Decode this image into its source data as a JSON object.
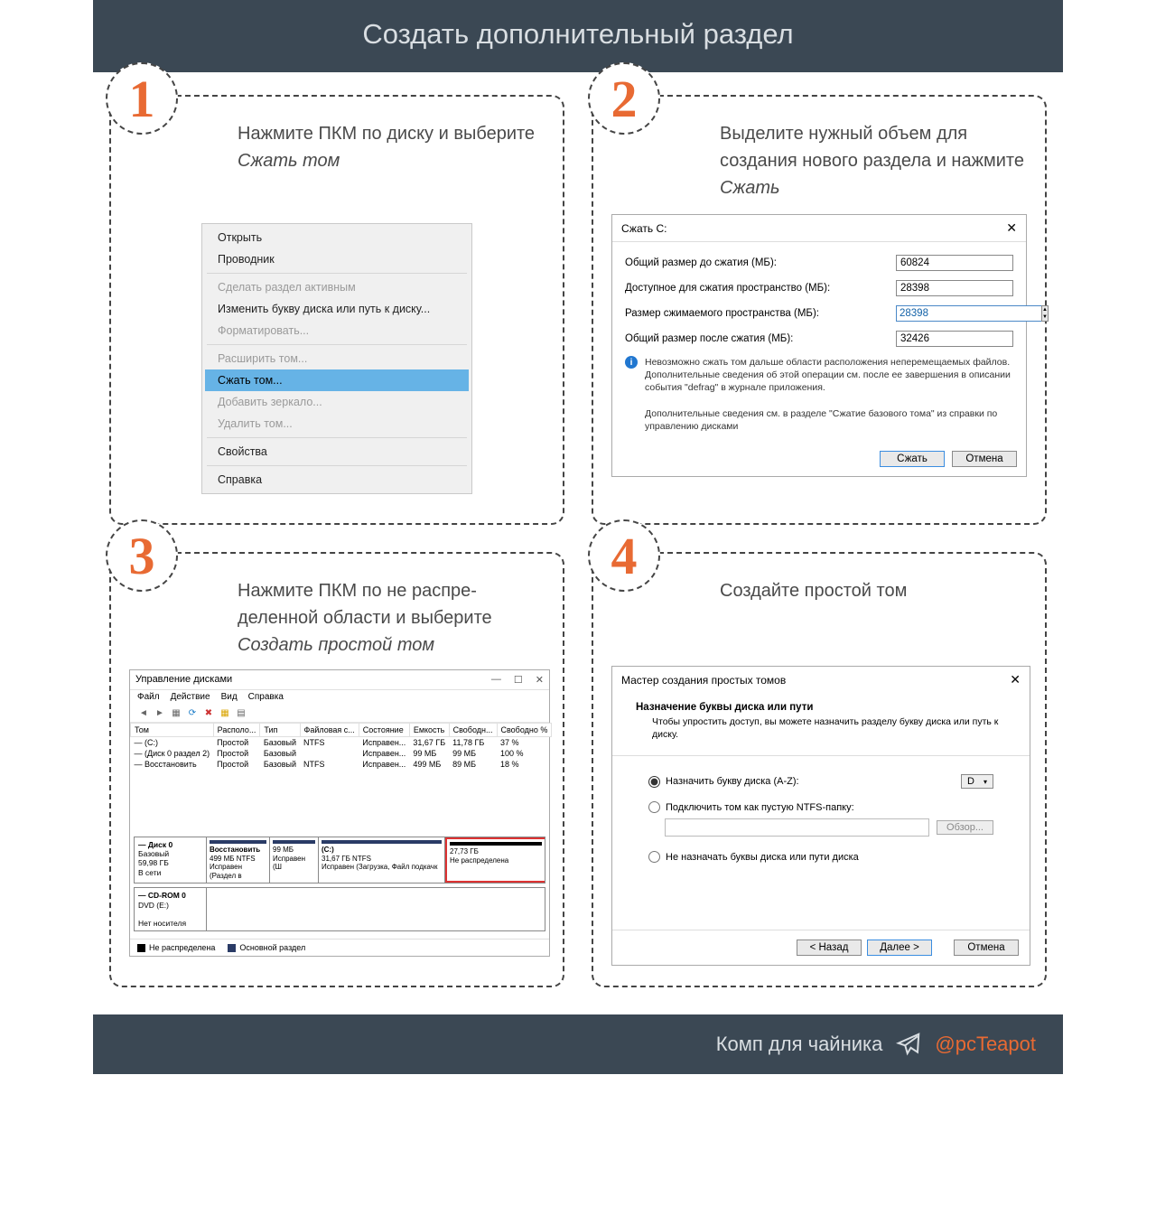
{
  "header": {
    "title": "Создать дополнительный раздел"
  },
  "steps": {
    "s1": {
      "num": "1",
      "desc1": "Нажмите ПКМ по диску и выберите ",
      "em": "Сжать том"
    },
    "s2": {
      "num": "2",
      "desc1": "Выделите нужный объем для создания нового раздела и нажмите ",
      "em": "Сжать"
    },
    "s3": {
      "num": "3",
      "desc1": "Нажмите ПКМ по не распре­деленной области и выберите ",
      "em": "Создать простой том"
    },
    "s4": {
      "num": "4",
      "desc1": "Создайте простой том",
      "em": ""
    }
  },
  "context_menu": {
    "open": "Открыть",
    "explorer": "Проводник",
    "make_active": "Сделать раздел активным",
    "change_letter": "Изменить букву диска или путь к диску...",
    "format": "Форматировать...",
    "extend": "Расширить том...",
    "shrink": "Сжать том...",
    "mirror": "Добавить зеркало...",
    "delete": "Удалить том...",
    "properties": "Свойства",
    "help": "Справка"
  },
  "shrink_dialog": {
    "title": "Сжать C:",
    "lbl_total": "Общий размер до сжатия (МБ):",
    "val_total": "60824",
    "lbl_avail": "Доступное для сжатия пространство (МБ):",
    "val_avail": "28398",
    "lbl_shrink": "Размер сжимаемого пространства (МБ):",
    "val_shrink": "28398",
    "lbl_after": "Общий размер после сжатия (МБ):",
    "val_after": "32426",
    "info1": "Невозможно сжать том дальше области расположения неперемещаемых файлов. Дополнительные сведения об этой операции см. после ее завершения в описании события \"defrag\" в журнале приложения.",
    "info2": "Дополнительные сведения см. в разделе \"Сжатие базового тома\" из справки по управлению дисками",
    "btn_shrink": "Сжать",
    "btn_cancel": "Отмена"
  },
  "disk_mgmt": {
    "title": "Управление дисками",
    "menu": {
      "file": "Файл",
      "action": "Действие",
      "view": "Вид",
      "help": "Справка"
    },
    "cols": {
      "vol": "Том",
      "layout": "Располо...",
      "type": "Тип",
      "fs": "Файловая с...",
      "state": "Состояние",
      "cap": "Емкость",
      "free": "Свободн...",
      "freep": "Свободно %"
    },
    "rows": [
      {
        "vol": "— (C:)",
        "layout": "Простой",
        "type": "Базовый",
        "fs": "NTFS",
        "state": "Исправен...",
        "cap": "31,67 ГБ",
        "free": "11,78 ГБ",
        "freep": "37 %"
      },
      {
        "vol": "— (Диск 0 раздел 2)",
        "layout": "Простой",
        "type": "Базовый",
        "fs": "",
        "state": "Исправен...",
        "cap": "99 МБ",
        "free": "99 МБ",
        "freep": "100 %"
      },
      {
        "vol": "— Восстановить",
        "layout": "Простой",
        "type": "Базовый",
        "fs": "NTFS",
        "state": "Исправен...",
        "cap": "499 МБ",
        "free": "89 МБ",
        "freep": "18 %"
      }
    ],
    "disk0": {
      "label_t": "— Диск 0",
      "label_b": "Базовый",
      "label_s": "59,98 ГБ",
      "label_o": "В сети",
      "p1": {
        "t": "Восстановить",
        "s": "499 МБ NTFS",
        "st": "Исправен (Раздел в"
      },
      "p2": {
        "t": "",
        "s": "99 МБ",
        "st": "Исправен (Ш"
      },
      "p3": {
        "t": "(C:)",
        "s": "31,67 ГБ NTFS",
        "st": "Исправен (Загрузка, Файл подкачк"
      },
      "p4": {
        "t": "",
        "s": "27,73 ГБ",
        "st": "Не распределена"
      }
    },
    "cdrom": {
      "label_t": "— CD-ROM 0",
      "label_d": "DVD (E:)",
      "label_n": "Нет носителя"
    },
    "legend": {
      "un": "Не распределена",
      "pr": "Основной раздел"
    }
  },
  "wizard": {
    "title": "Мастер создания простых томов",
    "head_t": "Назначение буквы диска или пути",
    "head_s": "Чтобы упростить доступ, вы можете назначить разделу букву диска или путь к диску.",
    "r1": "Назначить букву диска (A-Z):",
    "drive": "D",
    "r2": "Подключить том как пустую NTFS-папку:",
    "browse": "Обзор...",
    "r3": "Не назначать буквы диска или пути диска",
    "back": "< Назад",
    "next": "Далее >",
    "cancel": "Отмена"
  },
  "footer": {
    "text": "Комп для чайника",
    "handle": "@pcTeapot"
  }
}
